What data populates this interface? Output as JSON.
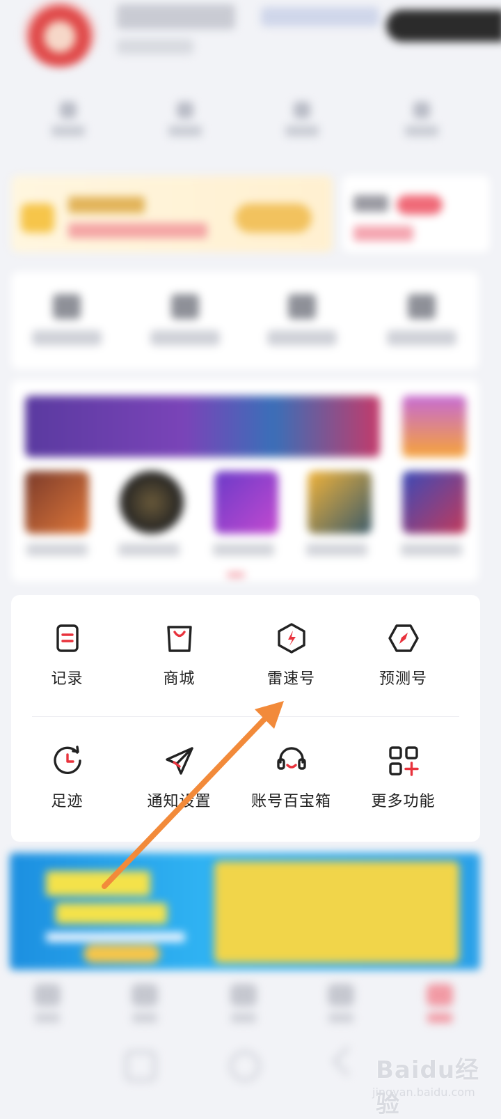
{
  "functions_row1": [
    {
      "label": "记录",
      "icon": "record-icon"
    },
    {
      "label": "商城",
      "icon": "shopping-bag-icon"
    },
    {
      "label": "雷速号",
      "icon": "lightning-hexagon-icon"
    },
    {
      "label": "预测号",
      "icon": "compass-hexagon-icon"
    }
  ],
  "functions_row2": [
    {
      "label": "足迹",
      "icon": "history-clock-icon"
    },
    {
      "label": "通知设置",
      "icon": "paper-plane-icon"
    },
    {
      "label": "账号百宝箱",
      "icon": "headset-icon"
    },
    {
      "label": "更多功能",
      "icon": "more-grid-plus-icon"
    }
  ],
  "watermark": {
    "main": "Baidu经验",
    "sub": "jingyan.baidu.com"
  },
  "colors": {
    "accent": "#e8323c",
    "arrow": "#f28a3a",
    "text": "#222222"
  }
}
